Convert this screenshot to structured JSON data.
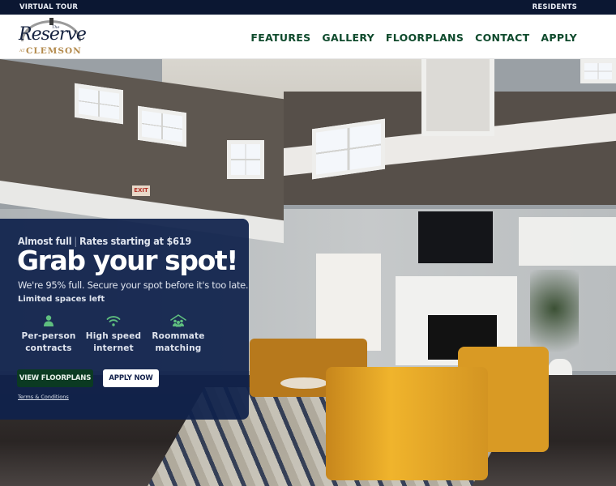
{
  "topbar": {
    "left_link": "VIRTUAL TOUR",
    "right_link": "RESIDENTS"
  },
  "header": {
    "logo": {
      "the": "The",
      "name": "Reserve",
      "at": "AT",
      "place": "CLEMSON"
    },
    "nav": [
      {
        "label": "FEATURES"
      },
      {
        "label": "GALLERY"
      },
      {
        "label": "FLOORPLANS"
      },
      {
        "label": "CONTACT"
      },
      {
        "label": "APPLY"
      }
    ]
  },
  "hero": {
    "exit_sign": "EXIT"
  },
  "promo": {
    "kicker_left": "Almost full",
    "kicker_sep": "|",
    "kicker_right": "Rates starting at $619",
    "headline": "Grab your spot!",
    "subtext": "We're 95% full. Secure your spot before it's too late.",
    "limited": "Limited spaces left",
    "features": [
      {
        "icon": "person-icon",
        "line1": "Per-person",
        "line2": "contracts"
      },
      {
        "icon": "wifi-icon",
        "line1": "High speed",
        "line2": "internet"
      },
      {
        "icon": "roommates-house-icon",
        "line1": "Roommate",
        "line2": "matching"
      }
    ],
    "primary_button": "VIEW FLOORPLANS",
    "secondary_button": "APPLY NOW",
    "terms_link": "Terms & Conditions"
  },
  "colors": {
    "navy": "#0b1732",
    "nav_green": "#0e4a2c",
    "icon_green": "#5fbf7f",
    "button_green": "#0b3a22",
    "logo_gold": "#b38a4c"
  }
}
